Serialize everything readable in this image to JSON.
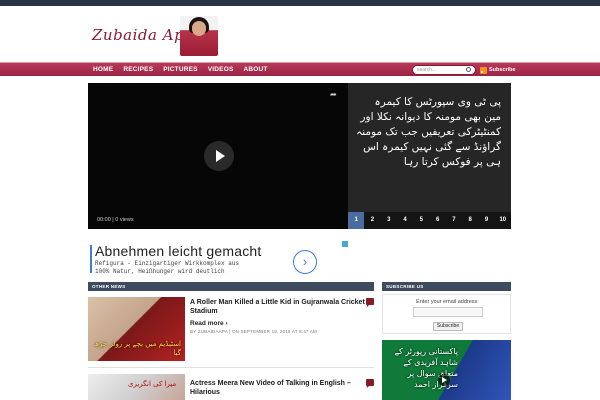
{
  "site": {
    "logo_text": "Zubaida Appa"
  },
  "nav": {
    "items": [
      "HOME",
      "RECIPES",
      "PICTURES",
      "VIDEOS",
      "ABOUT"
    ],
    "search_placeholder": "search...",
    "subscribe_label": "Subscribe"
  },
  "player": {
    "meta": "00:00 | 0 views"
  },
  "featured": {
    "caption": "پی ٹی وی سپورٹس کا کیمرہ مین بھی مومنہ کا دیوانہ نکلا اور کمنٹیٹرکی تعریفیں جب تک مومنہ گراؤنڈ سے گئی نہیں کیمرہ اس ہی پر فوکس کرتا رہا",
    "pages": [
      "1",
      "2",
      "3",
      "4",
      "5",
      "6",
      "7",
      "8",
      "9",
      "10"
    ],
    "active_page": "1"
  },
  "ad": {
    "title": "Abnehmen leicht gemacht",
    "body_line1": "Refigura - Einzigartiger Wirkkomplex aus",
    "body_line2": "100% Natur, Heißhunger wird deutlich"
  },
  "other_news": {
    "heading": "OTHER NEWS",
    "posts": [
      {
        "title": "A Roller Man Killed a Little Kid in Gujranwala Cricket Stadium",
        "read_more": "Read more ›",
        "meta": "BY ZUBAIDAAPA | ON SEPTEMBER 19, 2016 AT 8:47 AM",
        "thumb_text": "اسٹیڈیم میں بچے پر رولر چڑھ گیا"
      },
      {
        "title": "Actress Meera New Video of Talking in English – Hilarious",
        "thumb_text": "میرا کی انگریزی"
      }
    ]
  },
  "subscribe_widget": {
    "heading": "SUBSCRIBE US",
    "label": "Enter your email address:",
    "button": "Subscribe"
  },
  "side_video": {
    "thumb_text": "پاکستانی رپورٹر کے شاہد آفریدی کے متعلق سوال پر سرفراز احمد"
  },
  "colors": {
    "nav_bg": "#9c2243",
    "section_bar": "#3e4a5e",
    "active_page": "#4a6c9e",
    "top_strip": "#2b3445"
  }
}
